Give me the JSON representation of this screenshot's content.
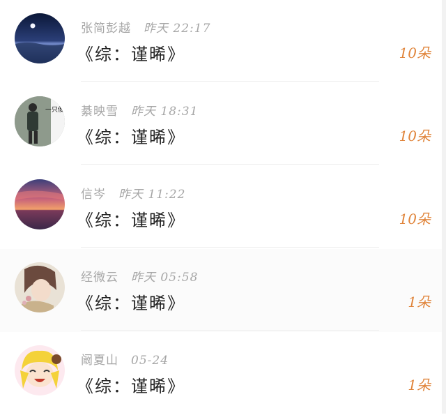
{
  "messages": [
    {
      "sender": "张简彭越",
      "time": "昨天 22:17",
      "text": "《综：谨晞》",
      "gift_count": "10朵",
      "avatar": "night-sea-avatar"
    },
    {
      "sender": "綦映雪",
      "time": "昨天 18:31",
      "text": "《综：谨晞》",
      "gift_count": "10朵",
      "avatar": "person-photo-avatar",
      "avatar_caption": "一只傻屌"
    },
    {
      "sender": "信岑",
      "time": "昨天 11:22",
      "text": "《综：谨晞》",
      "gift_count": "10朵",
      "avatar": "sunset-avatar"
    },
    {
      "sender": "经微云",
      "time": "昨天 05:58",
      "text": "《综：谨晞》",
      "gift_count": "1朵",
      "avatar": "anime-boy-avatar"
    },
    {
      "sender": "阚夏山",
      "time": "05-24",
      "text": "《综：谨晞》",
      "gift_count": "1朵",
      "avatar": "chibi-girl-avatar"
    }
  ],
  "colors": {
    "count": "#e0843a",
    "meta": "#a6a6a6",
    "text": "#222222"
  }
}
